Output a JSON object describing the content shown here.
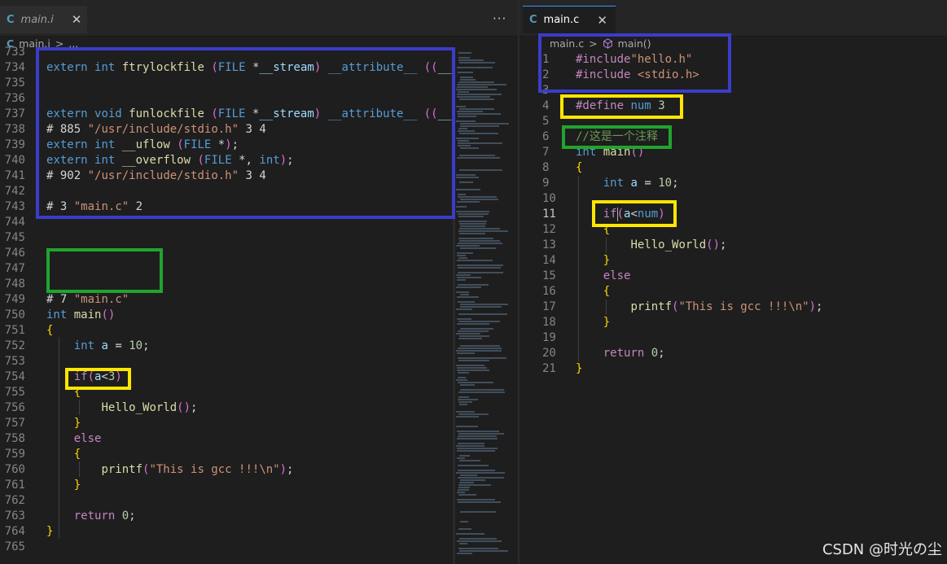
{
  "left_editor": {
    "tab": {
      "icon": "c-file-icon",
      "icon_text": "C",
      "name": "main.i",
      "close": "✕"
    },
    "more_actions": "···",
    "breadcrumb": {
      "icon_text": "C",
      "file": "main.i",
      "sep": ">",
      "rest": "..."
    },
    "lines": [
      {
        "n": "733",
        "code": ""
      },
      {
        "n": "734",
        "code": "extern int ftrylockfile (FILE *__stream) __attribute__ ((__"
      },
      {
        "n": "735",
        "code": ""
      },
      {
        "n": "736",
        "code": ""
      },
      {
        "n": "737",
        "code": "extern void funlockfile (FILE *__stream) __attribute__ ((__"
      },
      {
        "n": "738",
        "code": "# 885 \"/usr/include/stdio.h\" 3 4"
      },
      {
        "n": "739",
        "code": "extern int __uflow (FILE *);"
      },
      {
        "n": "740",
        "code": "extern int __overflow (FILE *, int);"
      },
      {
        "n": "741",
        "code": "# 902 \"/usr/include/stdio.h\" 3 4"
      },
      {
        "n": "742",
        "code": ""
      },
      {
        "n": "743",
        "code": "# 3 \"main.c\" 2"
      },
      {
        "n": "744",
        "code": ""
      },
      {
        "n": "745",
        "code": ""
      },
      {
        "n": "746",
        "code": ""
      },
      {
        "n": "747",
        "code": ""
      },
      {
        "n": "748",
        "code": ""
      },
      {
        "n": "749",
        "code": "# 7 \"main.c\""
      },
      {
        "n": "750",
        "code": "int main()"
      },
      {
        "n": "751",
        "code": "{"
      },
      {
        "n": "752",
        "code": "    int a = 10;"
      },
      {
        "n": "753",
        "code": ""
      },
      {
        "n": "754",
        "code": "    if(a<3)"
      },
      {
        "n": "755",
        "code": "    {"
      },
      {
        "n": "756",
        "code": "        Hello_World();"
      },
      {
        "n": "757",
        "code": "    }"
      },
      {
        "n": "758",
        "code": "    else"
      },
      {
        "n": "759",
        "code": "    {"
      },
      {
        "n": "760",
        "code": "        printf(\"This is gcc !!!\\n\");"
      },
      {
        "n": "761",
        "code": "    }"
      },
      {
        "n": "762",
        "code": ""
      },
      {
        "n": "763",
        "code": "    return 0;"
      },
      {
        "n": "764",
        "code": "}"
      },
      {
        "n": "765",
        "code": ""
      }
    ]
  },
  "right_editor": {
    "tab": {
      "icon": "c-file-icon",
      "icon_text": "C",
      "name": "main.c",
      "close": "✕"
    },
    "breadcrumb": {
      "file": "main.c",
      "sep": ">",
      "symbol_icon": "cube-symbol-icon",
      "symbol": "main()"
    },
    "lines": [
      {
        "n": "1",
        "code": "#include\"hello.h\""
      },
      {
        "n": "2",
        "code": "#include <stdio.h>"
      },
      {
        "n": "3",
        "code": ""
      },
      {
        "n": "4",
        "code": "#define num 3"
      },
      {
        "n": "5",
        "code": ""
      },
      {
        "n": "6",
        "code": "//这是一个注释"
      },
      {
        "n": "7",
        "code": "int main()"
      },
      {
        "n": "8",
        "code": "{"
      },
      {
        "n": "9",
        "code": "    int a = 10;"
      },
      {
        "n": "10",
        "code": ""
      },
      {
        "n": "11",
        "code": "    if(a<num)"
      },
      {
        "n": "12",
        "code": "    {"
      },
      {
        "n": "13",
        "code": "        Hello_World();"
      },
      {
        "n": "14",
        "code": "    }"
      },
      {
        "n": "15",
        "code": "    else"
      },
      {
        "n": "16",
        "code": "    {"
      },
      {
        "n": "17",
        "code": "        printf(\"This is gcc !!!\\n\");"
      },
      {
        "n": "18",
        "code": "    }"
      },
      {
        "n": "19",
        "code": ""
      },
      {
        "n": "20",
        "code": "    return 0;"
      },
      {
        "n": "21",
        "code": "}"
      }
    ],
    "current_line": "11"
  },
  "watermark": "CSDN @时光の尘",
  "colors": {
    "background": "#1e1e1e",
    "highlight_blue": "#3c3ccb",
    "highlight_green": "#20a42e",
    "highlight_yellow": "#ffe600"
  }
}
